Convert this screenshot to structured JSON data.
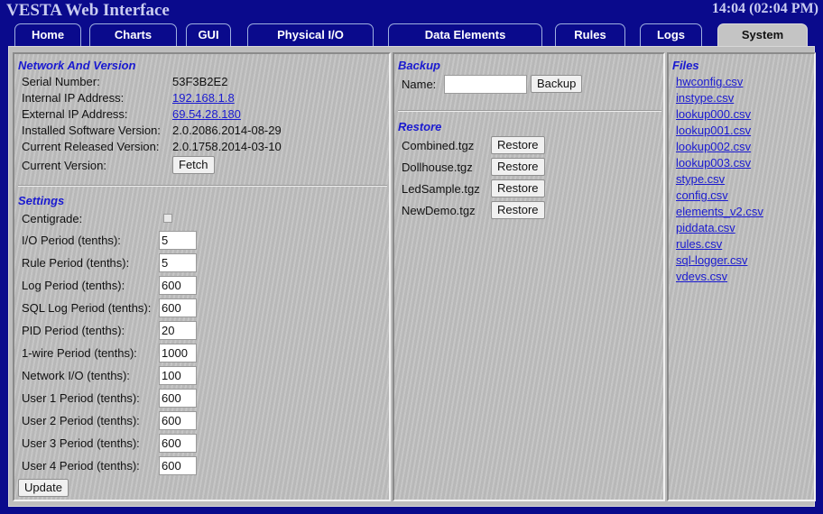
{
  "header": {
    "title": "VESTA Web Interface",
    "clock": "14:04 (02:04 PM)"
  },
  "tabs": [
    {
      "label": "Home"
    },
    {
      "label": "Charts"
    },
    {
      "label": "GUI"
    },
    {
      "label": "Physical I/O"
    },
    {
      "label": "Data Elements"
    },
    {
      "label": "Rules"
    },
    {
      "label": "Logs"
    },
    {
      "label": "System",
      "active": true
    }
  ],
  "network": {
    "title": "Network And Version",
    "serial_label": "Serial Number:",
    "serial_value": "53F3B2E2",
    "internal_ip_label": "Internal IP Address:",
    "internal_ip_value": "192.168.1.8",
    "external_ip_label": "External IP Address:",
    "external_ip_value": "69.54.28.180",
    "installed_label": "Installed Software Version:",
    "installed_value": "2.0.2086.2014-08-29",
    "released_label": "Current Released Version:",
    "released_value": "2.0.1758.2014-03-10",
    "current_label": "Current Version:",
    "fetch_label": "Fetch"
  },
  "settings": {
    "title": "Settings",
    "centigrade_label": "Centigrade:",
    "centigrade_checked": false,
    "fields": [
      {
        "label": "I/O Period (tenths):",
        "value": "5"
      },
      {
        "label": "Rule Period (tenths):",
        "value": "5"
      },
      {
        "label": "Log Period (tenths):",
        "value": "600"
      },
      {
        "label": "SQL Log Period (tenths):",
        "value": "600"
      },
      {
        "label": "PID Period (tenths):",
        "value": "20"
      },
      {
        "label": "1-wire Period (tenths):",
        "value": "1000"
      },
      {
        "label": "Network I/O (tenths):",
        "value": "100"
      },
      {
        "label": "User 1 Period (tenths):",
        "value": "600"
      },
      {
        "label": "User 2 Period (tenths):",
        "value": "600"
      },
      {
        "label": "User 3 Period (tenths):",
        "value": "600"
      },
      {
        "label": "User 4 Period (tenths):",
        "value": "600"
      }
    ],
    "update_label": "Update"
  },
  "backup": {
    "title": "Backup",
    "name_label": "Name:",
    "name_value": "",
    "backup_label": "Backup"
  },
  "restore": {
    "title": "Restore",
    "button_label": "Restore",
    "items": [
      {
        "file": "Combined.tgz"
      },
      {
        "file": "Dollhouse.tgz"
      },
      {
        "file": "LedSample.tgz"
      },
      {
        "file": "NewDemo.tgz"
      }
    ]
  },
  "files": {
    "title": "Files",
    "items": [
      "hwconfig.csv",
      "instype.csv",
      "lookup000.csv",
      "lookup001.csv",
      "lookup002.csv",
      "lookup003.csv",
      "stype.csv",
      "config.csv",
      "elements_v2.csv",
      "piddata.csv",
      "rules.csv",
      "sql-logger.csv",
      "vdevs.csv"
    ]
  },
  "colors": {
    "background": "#0a0a8c",
    "section_title": "#1a1ad0",
    "panel": "#c2c2c2"
  }
}
